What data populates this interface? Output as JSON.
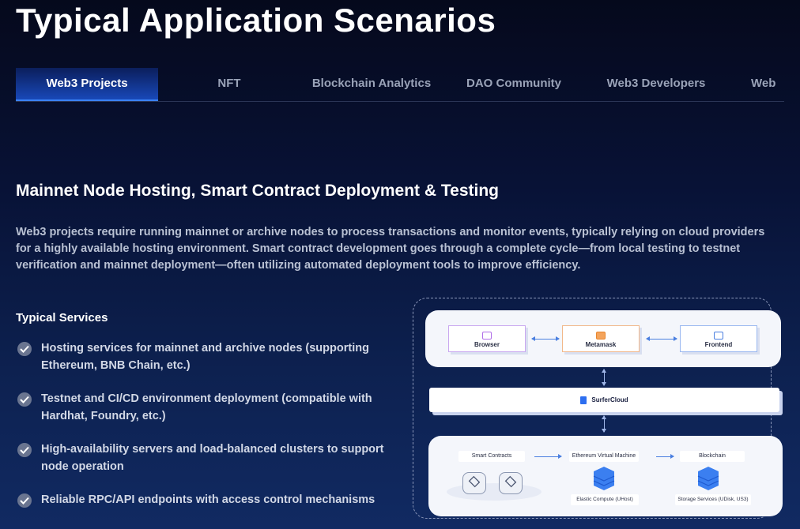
{
  "page": {
    "title": "Typical Application Scenarios"
  },
  "tabs": [
    {
      "label": "Web3 Projects",
      "active": true
    },
    {
      "label": "NFT"
    },
    {
      "label": "Blockchain Analytics"
    },
    {
      "label": "DAO Community"
    },
    {
      "label": "Web3 Developers"
    },
    {
      "label": "Web"
    }
  ],
  "section": {
    "title": "Mainnet Node Hosting, Smart Contract Deployment & Testing",
    "description": "Web3 projects require running mainnet or archive nodes to process transactions and monitor events, typically relying on cloud providers for a highly available hosting environment. Smart contract development goes through a complete cycle—from local testing to testnet verification and mainnet deployment—often utilizing automated deployment tools to improve efficiency."
  },
  "services": {
    "title": "Typical Services",
    "items": [
      "Hosting services for mainnet and archive nodes (supporting Ethereum, BNB Chain, etc.)",
      "Testnet and CI/CD environment deployment (compatible with Hardhat, Foundry, etc.)",
      "High-availability servers and load-balanced clusters to support node operation",
      "Reliable RPC/API endpoints with access control mechanisms"
    ]
  },
  "diagram": {
    "top": {
      "browser": "Browser",
      "metamask": "Metamask",
      "frontend": "Frontend"
    },
    "middle": "SurferCloud",
    "bottom": {
      "smart_contracts": "Smart Contracts",
      "evm": "Ethereum Virtual Machine",
      "blockchain": "Blockchain",
      "elastic_compute": "Elastic Compute (UHost)",
      "storage": "Storage Services (UDisk, US3)"
    }
  },
  "colors": {
    "accent": "#3b82f6",
    "tab_active_bg": "#1848b8",
    "bg_dark": "#05091c"
  }
}
